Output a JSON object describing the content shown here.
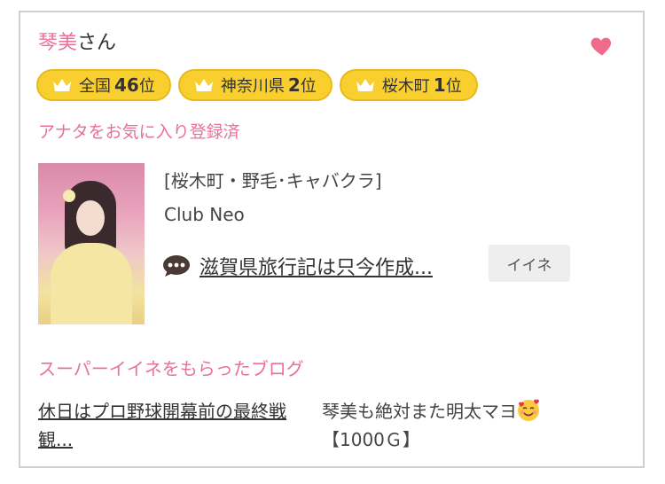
{
  "profile": {
    "name": "琴美",
    "honorific": "さん",
    "favorite_status": "アナタをお気に入り登録済"
  },
  "rankings": [
    {
      "area": "全国",
      "rank": "46",
      "suffix": "位"
    },
    {
      "area": "神奈川県",
      "rank": "2",
      "suffix": "位"
    },
    {
      "area": "桜木町",
      "rank": "1",
      "suffix": "位"
    }
  ],
  "shop": {
    "category": "[桜木町・野毛･キャバクラ]",
    "name": "Club Neo"
  },
  "latest_blog": {
    "title": "滋賀県旅行記は只今作成...",
    "like_label": "イイネ"
  },
  "super_iine": {
    "heading": "スーパーイイネをもらったブログ",
    "post_title": "休日はプロ野球開幕前の最終戦観...",
    "comment": "琴美も絶対また明太マヨ",
    "points": "【1000Ｇ】"
  },
  "icons": {
    "heart": "heart-icon",
    "crown": "crown-icon",
    "speech_bubble": "speech-bubble-icon",
    "emoji": "smiling-face-with-hearts-emoji"
  },
  "colors": {
    "accent_pink": "#e8709b",
    "badge_yellow": "#f9cf30",
    "heart": "#f06b8a"
  }
}
